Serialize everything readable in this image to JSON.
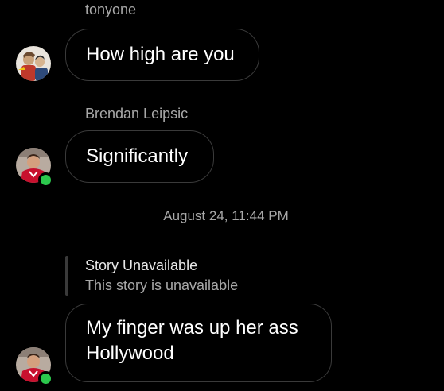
{
  "messages": [
    {
      "sender": "tonyone",
      "text": "How high are you",
      "avatar_icon": "cartoon-avatar-icon"
    },
    {
      "sender": "Brendan Leipsic",
      "text": "Significantly",
      "avatar_icon": "hockey-player-avatar-icon",
      "online": true
    }
  ],
  "timestamp": "August 24, 11:44 PM",
  "story_reply": {
    "title": "Story Unavailable",
    "subtitle": "This story is unavailable",
    "message_line1": "My finger was up her ass",
    "message_line2": "Hollywood",
    "avatar_icon": "hockey-player-avatar-icon",
    "online": true
  },
  "colors": {
    "background": "#000000",
    "bubble_border": "#3a3a3a",
    "secondary_text": "#a8a8a8",
    "online_indicator": "#2cc84d"
  }
}
